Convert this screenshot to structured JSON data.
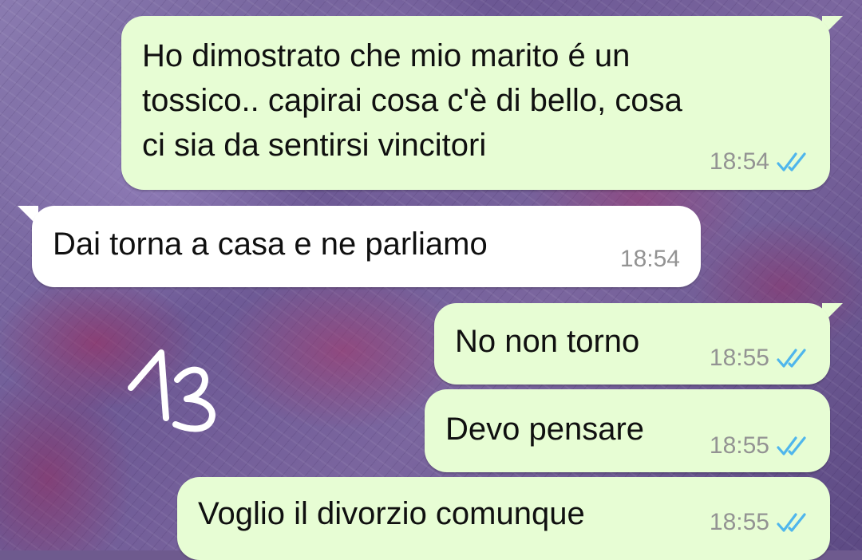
{
  "colors": {
    "outgoing_bubble": "#e7fdd4",
    "incoming_bubble": "#ffffff",
    "time_text": "#939393",
    "read_ticks": "#4fb6ec"
  },
  "annotation": {
    "handwritten_number": "13"
  },
  "messages": [
    {
      "direction": "outgoing",
      "text": "Ho dimostrato che mio marito é un\ntossico.. capirai cosa c'è di bello, cosa\nci sia da sentirsi vincitori",
      "time": "18:54",
      "status_icon": "double-check-read-icon"
    },
    {
      "direction": "incoming",
      "text": "Dai torna a casa e ne parliamo",
      "time": "18:54"
    },
    {
      "direction": "outgoing",
      "text": "No non torno",
      "time": "18:55",
      "status_icon": "double-check-read-icon"
    },
    {
      "direction": "outgoing",
      "text": "Devo pensare",
      "time": "18:55",
      "status_icon": "double-check-read-icon"
    },
    {
      "direction": "outgoing",
      "text": "Voglio il divorzio comunque",
      "time": "18:55",
      "status_icon": "double-check-read-icon"
    }
  ]
}
